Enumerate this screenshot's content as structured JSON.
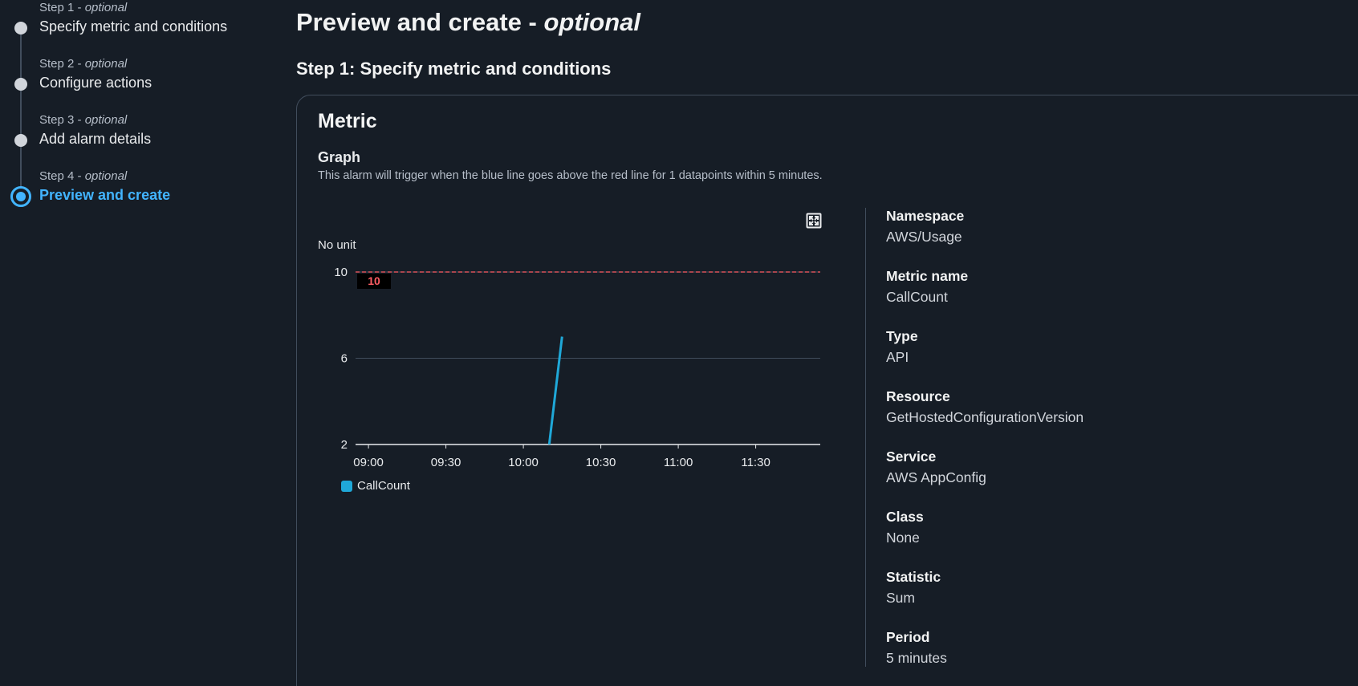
{
  "sidebar": {
    "steps": [
      {
        "prefix": "Step 1 -",
        "optional": "optional",
        "title": "Specify metric and conditions",
        "active": false
      },
      {
        "prefix": "Step 2 -",
        "optional": "optional",
        "title": "Configure actions",
        "active": false
      },
      {
        "prefix": "Step 3 -",
        "optional": "optional",
        "title": "Add alarm details",
        "active": false
      },
      {
        "prefix": "Step 4 -",
        "optional": "optional",
        "title": "Preview and create",
        "active": true
      }
    ]
  },
  "main": {
    "title": "Preview and create -",
    "title_optional": "optional",
    "section_title": "Step 1: Specify metric and conditions",
    "card_title": "Metric",
    "graph_label": "Graph",
    "graph_desc": "This alarm will trigger when the blue line goes above the red line for 1 datapoints within 5 minutes.",
    "unit_label": "No unit"
  },
  "chart_data": {
    "type": "line",
    "ylim": [
      2,
      10
    ],
    "yticks": [
      10,
      6,
      2
    ],
    "xticks": [
      "09:00",
      "09:30",
      "10:00",
      "10:30",
      "11:00",
      "11:30"
    ],
    "xlim": [
      "08:55",
      "11:55"
    ],
    "threshold": {
      "value": 10,
      "label": "10",
      "color": "#ff5d64"
    },
    "series": [
      {
        "name": "CallCount",
        "color": "#1fa8d8",
        "points": [
          {
            "x": "10:10",
            "y": 2
          },
          {
            "x": "10:15",
            "y": 7
          }
        ]
      }
    ],
    "grid": true,
    "legend": "bottom-left"
  },
  "details": [
    {
      "key": "Namespace",
      "value": "AWS/Usage"
    },
    {
      "key": "Metric name",
      "value": "CallCount"
    },
    {
      "key": "Type",
      "value": "API"
    },
    {
      "key": "Resource",
      "value": "GetHostedConfigurationVersion"
    },
    {
      "key": "Service",
      "value": "AWS AppConfig"
    },
    {
      "key": "Class",
      "value": "None"
    },
    {
      "key": "Statistic",
      "value": "Sum"
    },
    {
      "key": "Period",
      "value": "5 minutes"
    }
  ],
  "colors": {
    "background": "#161d26",
    "accent": "#42b4ff",
    "threshold": "#ff5d64",
    "series": "#1fa8d8"
  },
  "icons": {
    "expand": "expand-fullscreen-icon"
  }
}
